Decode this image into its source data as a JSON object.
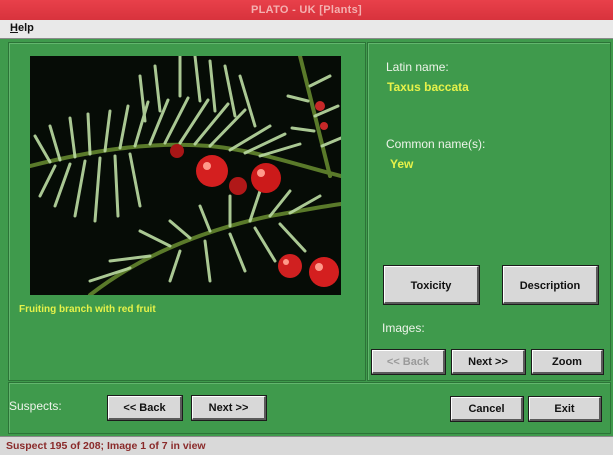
{
  "window": {
    "title": "PLATO - UK [Plants]"
  },
  "menu": {
    "help_label": "Help",
    "help_mnemonic": "H",
    "help_rest": "elp"
  },
  "photo": {
    "caption": "Fruiting branch with red fruit",
    "image_icon": "yew-branch-photo"
  },
  "details": {
    "latin_label": "Latin name:",
    "latin_value": "Taxus baccata",
    "common_label": "Common name(s):",
    "common_value": "Yew"
  },
  "buttons": {
    "toxicity": "Toxicity",
    "description": "Description",
    "images_back": "<< Back",
    "images_next": "Next >>",
    "zoom": "Zoom",
    "suspects_back": "<< Back",
    "suspects_next": "Next >>",
    "cancel": "Cancel",
    "exit": "Exit"
  },
  "labels": {
    "images": "Images:",
    "suspects": "Suspects:"
  },
  "status": {
    "text": "Suspect 195 of 208;  Image 1 of 7 in view"
  },
  "colors": {
    "title_bar": "#d8333d",
    "panel_green": "#3f9a4c",
    "value_yellow": "#e6f24a"
  }
}
